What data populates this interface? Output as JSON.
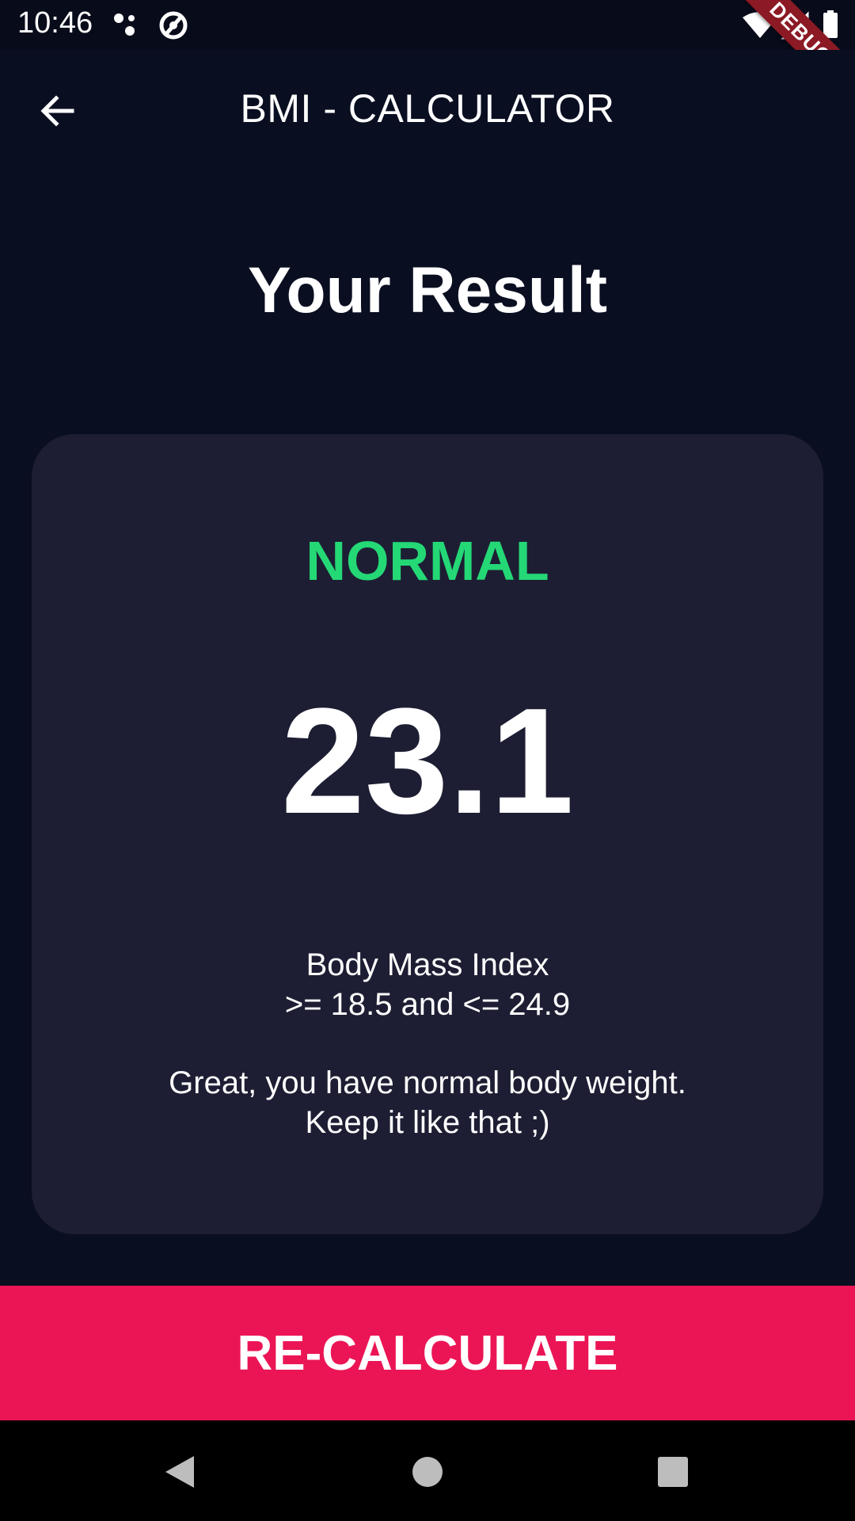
{
  "status_bar": {
    "time": "10:46",
    "debug_label": "DEBUG",
    "icons": [
      "assistant-dots-icon",
      "sync-icon",
      "wifi-icon",
      "signal-icon",
      "battery-icon"
    ]
  },
  "app_bar": {
    "title": "BMI - CALCULATOR",
    "back_icon": "arrow-back-icon"
  },
  "main": {
    "heading": "Your Result",
    "result": {
      "status": "NORMAL",
      "status_color": "#24d876",
      "bmi_value": "23.1",
      "range_label": "Body Mass Index",
      "range": ">= 18.5 and <= 24.9",
      "advice_line_1": "Great, you have normal body weight.",
      "advice_line_2": "Keep it like that ;)"
    }
  },
  "footer": {
    "button_label": "RE-CALCULATE",
    "button_color": "#eb1555"
  },
  "colors": {
    "background": "#0a0e21",
    "card": "#1d1e33"
  },
  "nav_bar": {
    "icons": [
      "nav-back-icon",
      "nav-home-icon",
      "nav-recents-icon"
    ]
  }
}
